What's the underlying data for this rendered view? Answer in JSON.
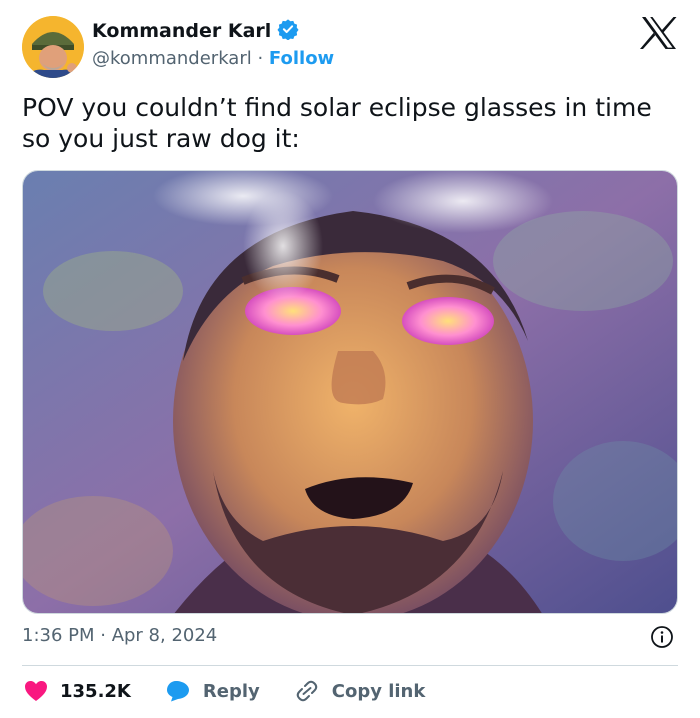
{
  "author": {
    "name": "Kommander Karl",
    "handle": "@kommanderkarl",
    "separator": " · ",
    "follow_label": "Follow",
    "verified_color": "#1d9bf0",
    "icons": {
      "verified": "verified-badge-icon",
      "platform": "x-logo-icon"
    }
  },
  "tweet": {
    "text": "POV you couldn’t find solar eclipse glasses in time so you just raw dog it:",
    "media": {
      "type": "photo",
      "subject": "man with beard gazing up at the sky, eyes glowing pink, smoke rising from his head"
    },
    "timestamp": "1:36 PM · Apr 8, 2024"
  },
  "actions": {
    "likes_count": "135.2K",
    "reply_label": "Reply",
    "copy_link_label": "Copy link",
    "colors": {
      "heart": "#f91880",
      "reply": "#1d9bf0",
      "muted": "#536471"
    }
  }
}
